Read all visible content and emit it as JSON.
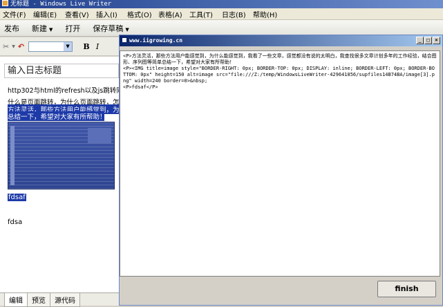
{
  "window": {
    "title": "无标题 - Windows Live Writer"
  },
  "menu": [
    "文件(F)",
    "编辑(E)",
    "查看(V)",
    "插入(I)",
    "格式(O)",
    "表格(A)",
    "工具(T)",
    "日志(B)",
    "帮助(H)"
  ],
  "toolbar": {
    "publish": "发布",
    "new": "新建",
    "open": "打开",
    "save_draft": "保存草稿"
  },
  "format_toolbar": {
    "font_value": "",
    "bold": "B",
    "italic": "I"
  },
  "editor": {
    "title_placeholder": "输入日志标题",
    "lines": [
      "http302与html的refresh以及js跳转同",
      "什么是页面跳转，为什么页面跳转，怎么",
      "方法灵活，那些方法用户能感觉到，为什",
      "总结一下，希望对大家有所帮助！"
    ],
    "selected_text": "fdsaf",
    "paragraph": "fdsa"
  },
  "tabs": [
    "编辑",
    "预览",
    "源代码"
  ],
  "popup": {
    "title": "www.iigrowing.cn",
    "source": "<P>方法灵活，那些方法用户能感觉到，为什么能感觉到，我看了一些文章，感觉都没有说的太明白，我查找很多文章计划多年的工作经验，结合图形、序列图等简单总结一下，希望对大家有所帮助！\n<P><IMG title=image style=\"BORDER-RIGHT: 0px; BORDER-TOP: 0px; DISPLAY: inline; BORDER-LEFT: 0px; BORDER-BOTTOM: 0px\" height=150 alt=image src=\"file:///Z:/temp/WindowsLiveWriter-429641856/supfiles14B74BA/image[3].png\" width=240 border=0>&nbsp;\n<P>fdsaf</P>",
    "finish": "finish",
    "min_icon": "_",
    "max_icon": "□",
    "close_icon": "×"
  },
  "colors": {
    "selection": "#1d3aa8",
    "title_bar": "#0a246a"
  }
}
